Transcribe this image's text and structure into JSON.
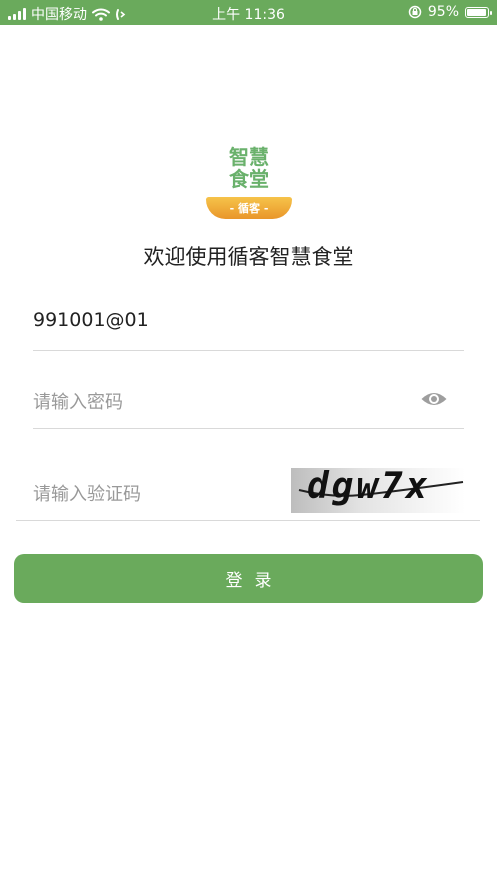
{
  "status_bar": {
    "carrier": "中国移动",
    "time": "上午 11:36",
    "battery": "95%",
    "battery_level": 0.95
  },
  "logo": {
    "line1": "智慧",
    "line2": "食堂",
    "bowl_label": "- 循客 -"
  },
  "welcome": "欢迎使用循客智慧食堂",
  "form": {
    "account_value": "991001@01",
    "password_placeholder": "请输入密码",
    "captcha_placeholder": "请输入验证码",
    "captcha_text": "dgw7x"
  },
  "login_label": "登录",
  "colors": {
    "primary": "#6aaa5c",
    "logo_green": "#6ab16c",
    "logo_orange": "#f0aa35"
  }
}
